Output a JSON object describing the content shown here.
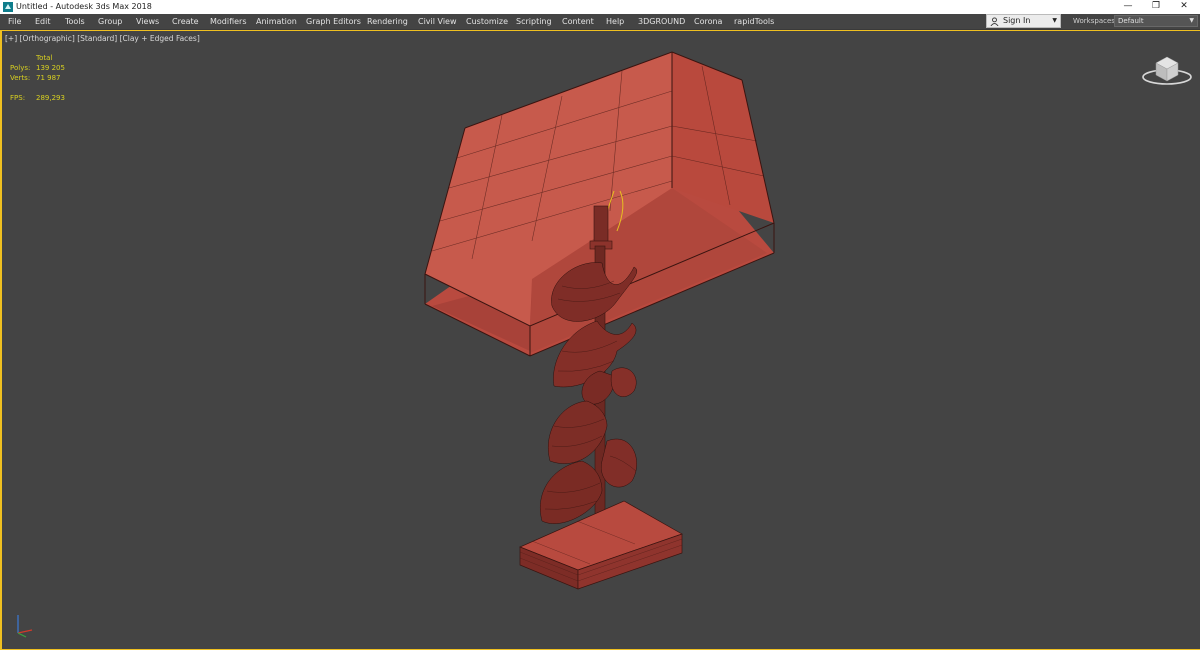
{
  "window": {
    "title": "Untitled - Autodesk 3ds Max 2018",
    "minimize_glyph": "—",
    "restore_glyph": "❐",
    "close_glyph": "✕"
  },
  "menu": [
    {
      "label": "File"
    },
    {
      "label": "Edit"
    },
    {
      "label": "Tools"
    },
    {
      "label": "Group"
    },
    {
      "label": "Views"
    },
    {
      "label": "Create"
    },
    {
      "label": "Modifiers"
    },
    {
      "label": "Animation"
    },
    {
      "label": "Graph Editors"
    },
    {
      "label": "Rendering"
    },
    {
      "label": "Civil View"
    },
    {
      "label": "Customize"
    },
    {
      "label": "Scripting"
    },
    {
      "label": "Content"
    },
    {
      "label": "Help"
    },
    {
      "label": "3DGROUND"
    },
    {
      "label": "Corona"
    },
    {
      "label": "rapidTools"
    }
  ],
  "account": {
    "signin_label": "Sign In",
    "icon": "user-icon"
  },
  "workspaces": {
    "label": "Workspaces:",
    "selected": "Default"
  },
  "viewport": {
    "labels": [
      "[+]",
      "[Orthographic]",
      "[Standard]",
      "[Clay + Edged Faces]"
    ],
    "stats": {
      "header": "Total",
      "polys_label": "Polys:",
      "polys_value": "139 205",
      "verts_label": "Verts:",
      "verts_value": "71 987",
      "fps_label": "FPS:",
      "fps_value": "289,293"
    },
    "active_border_color": "#f0c020",
    "model_color": "#c4564a"
  }
}
